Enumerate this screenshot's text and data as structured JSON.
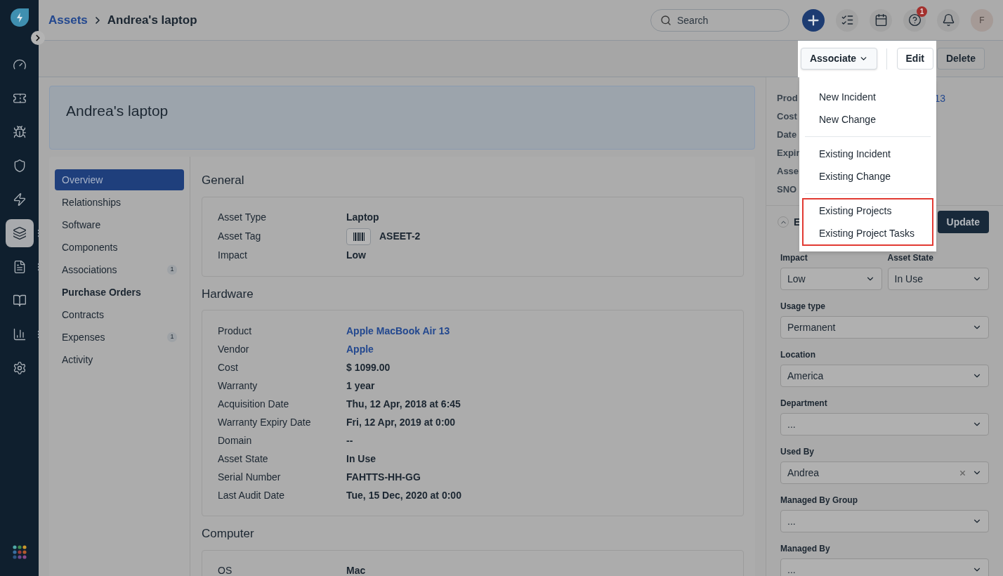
{
  "breadcrumb": {
    "parent": "Assets",
    "current": "Andrea's laptop"
  },
  "search": {
    "placeholder": "Search"
  },
  "help_badge": "1",
  "avatar_initial": "F",
  "nav": [
    {
      "kind": "gauge",
      "selected": false,
      "more": false
    },
    {
      "kind": "ticket",
      "selected": false,
      "more": false
    },
    {
      "kind": "bug",
      "selected": false,
      "more": false
    },
    {
      "kind": "shield",
      "selected": false,
      "more": false
    },
    {
      "kind": "bolt",
      "selected": false,
      "more": false
    },
    {
      "kind": "layers",
      "selected": true,
      "more": true
    },
    {
      "kind": "document",
      "selected": false,
      "more": true
    },
    {
      "kind": "book",
      "selected": false,
      "more": false
    },
    {
      "kind": "chart",
      "selected": false,
      "more": true
    },
    {
      "kind": "settings",
      "selected": false,
      "more": false
    }
  ],
  "actions": {
    "associate": "Associate",
    "edit": "Edit",
    "delete": "Delete"
  },
  "associate_menu": [
    {
      "highlighted": false,
      "items": [
        "New Incident",
        "New Change"
      ]
    },
    {
      "highlighted": false,
      "items": [
        "Existing Incident",
        "Existing Change"
      ]
    },
    {
      "highlighted": true,
      "items": [
        "Existing Projects",
        "Existing Project Tasks"
      ]
    }
  ],
  "asset_title": "Andrea's laptop",
  "tabs": [
    {
      "label": "Overview",
      "selected": true,
      "emphasized": false
    },
    {
      "label": "Relationships",
      "selected": false,
      "emphasized": false
    },
    {
      "label": "Software",
      "selected": false,
      "emphasized": false
    },
    {
      "label": "Components",
      "selected": false,
      "emphasized": false
    },
    {
      "label": "Associations",
      "selected": false,
      "emphasized": false,
      "count": "1"
    },
    {
      "label": "Purchase Orders",
      "selected": false,
      "emphasized": true
    },
    {
      "label": "Contracts",
      "selected": false,
      "emphasized": false
    },
    {
      "label": "Expenses",
      "selected": false,
      "emphasized": false,
      "count": "1"
    },
    {
      "label": "Activity",
      "selected": false,
      "emphasized": false
    }
  ],
  "sections": [
    {
      "title": "General",
      "fields": [
        {
          "label": "Asset Type",
          "value": "Laptop",
          "kind": "text"
        },
        {
          "label": "Asset Tag",
          "value": "ASEET-2",
          "kind": "tag"
        },
        {
          "label": "Impact",
          "value": "Low",
          "kind": "text"
        }
      ]
    },
    {
      "title": "Hardware",
      "fields": [
        {
          "label": "Product",
          "value": "Apple MacBook Air 13",
          "kind": "link"
        },
        {
          "label": "Vendor",
          "value": "Apple",
          "kind": "link"
        },
        {
          "label": "Cost",
          "value": "$ 1099.00",
          "kind": "text"
        },
        {
          "label": "Warranty",
          "value": "1 year",
          "kind": "text"
        },
        {
          "label": "Acquisition Date",
          "value": "Thu, 12 Apr, 2018 at 6:45",
          "kind": "text"
        },
        {
          "label": "Warranty Expiry Date",
          "value": "Fri, 12 Apr, 2019 at 0:00",
          "kind": "text"
        },
        {
          "label": "Domain",
          "value": "--",
          "kind": "text"
        },
        {
          "label": "Asset State",
          "value": "In Use",
          "kind": "text"
        },
        {
          "label": "Serial Number",
          "value": "FAHTTS-HH-GG",
          "kind": "text"
        },
        {
          "label": "Last Audit Date",
          "value": "Tue, 15 Dec, 2020 at 0:00",
          "kind": "text"
        }
      ]
    },
    {
      "title": "Computer",
      "fields": [
        {
          "label": "OS",
          "value": "Mac",
          "kind": "text"
        }
      ]
    }
  ],
  "summary": [
    {
      "label": "Prod",
      "value": "13"
    },
    {
      "label": "Cost"
    },
    {
      "label": "Date"
    },
    {
      "label": "Expir"
    },
    {
      "label": "Asse"
    },
    {
      "label": "SNO"
    }
  ],
  "properties": {
    "header": "E",
    "update": "Update",
    "rows": [
      [
        {
          "label": "Impact",
          "value": "Low",
          "clearable": false
        },
        {
          "label": "Asset State",
          "value": "In Use",
          "clearable": false
        }
      ],
      [
        {
          "label": "Usage type",
          "value": "Permanent",
          "clearable": false
        }
      ],
      [
        {
          "label": "Location",
          "value": "America",
          "clearable": false
        }
      ],
      [
        {
          "label": "Department",
          "value": "...",
          "clearable": false
        }
      ],
      [
        {
          "label": "Used By",
          "value": "Andrea",
          "clearable": true
        }
      ],
      [
        {
          "label": "Managed By Group",
          "value": "...",
          "clearable": false
        }
      ],
      [
        {
          "label": "Managed By",
          "value": "...",
          "clearable": false
        }
      ]
    ]
  }
}
